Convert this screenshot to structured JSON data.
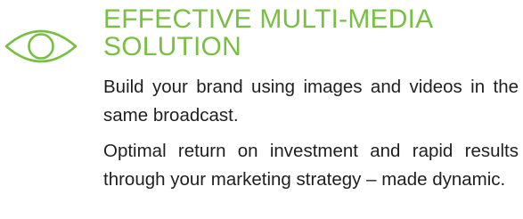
{
  "feature": {
    "icon": "eye-icon",
    "accent_color": "#79bf43",
    "title_line1": "EFFECTIVE MULTI-MEDIA",
    "title_line2": "SOLUTION",
    "paragraphs": [
      "Build your brand using images and videos in the same broadcast.",
      "Optimal return on investment and rapid results through your marketing strategy – made dynamic."
    ]
  }
}
